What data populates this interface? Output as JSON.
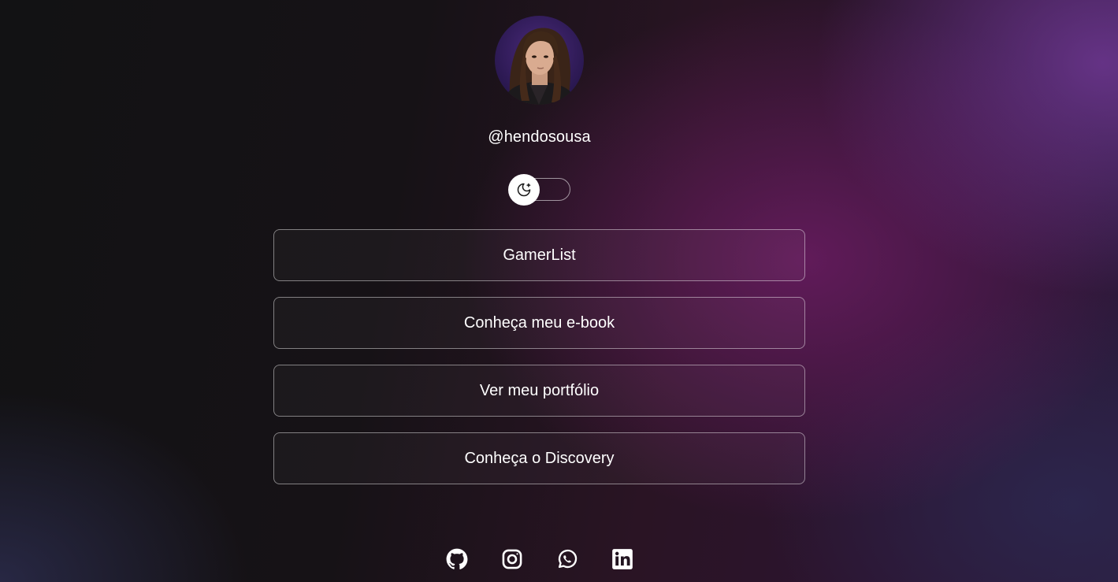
{
  "profile": {
    "username": "@hendosousa"
  },
  "theme_toggle": {
    "icon": "moon-stars-icon",
    "state": "dark"
  },
  "links": [
    {
      "label": "GamerList"
    },
    {
      "label": "Conheça meu e-book"
    },
    {
      "label": "Ver meu portfólio"
    },
    {
      "label": "Conheça o Discovery"
    }
  ],
  "socials": [
    {
      "icon": "github-icon"
    },
    {
      "icon": "instagram-icon"
    },
    {
      "icon": "whatsapp-icon"
    },
    {
      "icon": "linkedin-icon"
    }
  ],
  "colors": {
    "text": "#ffffff",
    "link_border": "#8a7a90",
    "accent_purple": "#5a2e7a"
  }
}
